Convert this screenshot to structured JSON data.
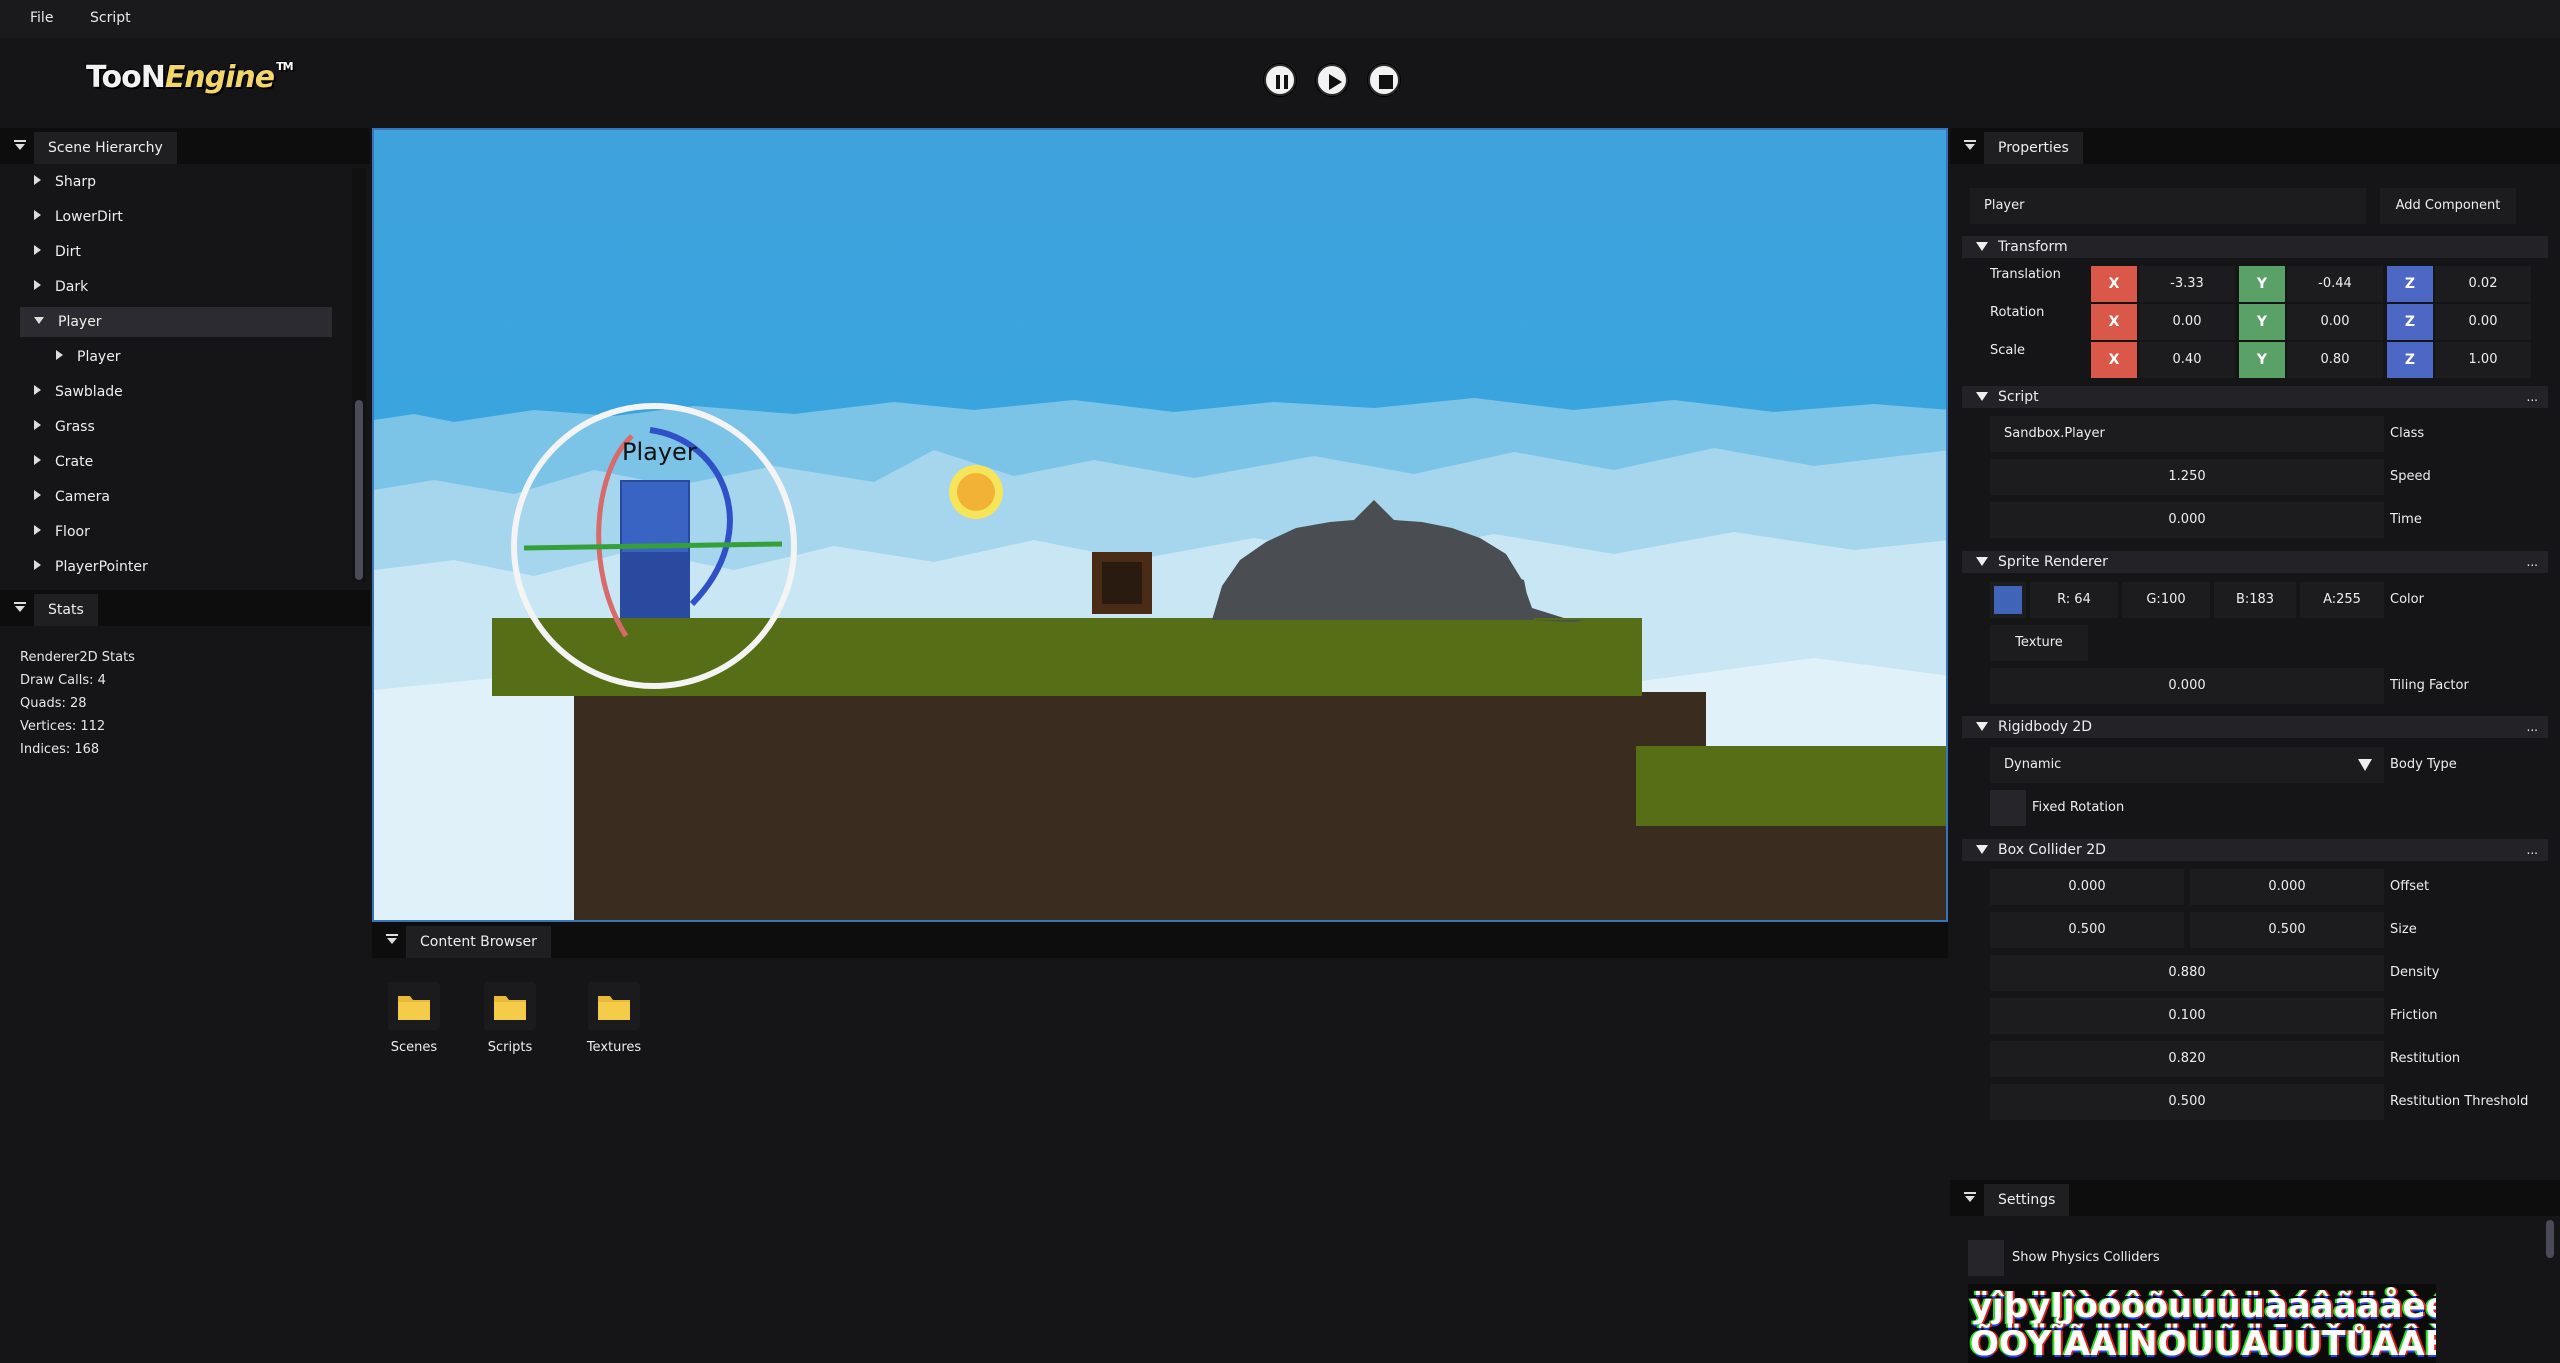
{
  "menu": {
    "file": "File",
    "script": "Script"
  },
  "logo": {
    "part1": "TooN",
    "part2": "Engine",
    "tm": "TM"
  },
  "playback": {
    "pause": "pause-icon",
    "play": "play-icon",
    "stop": "stop-icon"
  },
  "hierarchy": {
    "tab": "Scene Hierarchy",
    "items": [
      "Sharp",
      "LowerDirt",
      "Dirt",
      "Dark",
      "Player",
      "Player",
      "Sawblade",
      "Grass",
      "Crate",
      "Camera",
      "Floor",
      "PlayerPointer"
    ]
  },
  "stats": {
    "tab": "Stats",
    "title": "Renderer2D Stats",
    "draw_calls": "Draw Calls: 4",
    "quads": "Quads: 28",
    "vertices": "Vertices: 112",
    "indices": "Indices: 168"
  },
  "viewport": {
    "entity_label": "Player",
    "sky_color": "#3fa2dc",
    "grass_color": "#566e15",
    "dirt_color": "#3a2d1f"
  },
  "content_browser": {
    "tab": "Content Browser",
    "folders": [
      "Scenes",
      "Scripts",
      "Textures"
    ]
  },
  "properties": {
    "tab": "Properties",
    "entity_name": "Player",
    "add_component": "Add Component",
    "transform": {
      "header": "Transform",
      "translation_label": "Translation",
      "rotation_label": "Rotation",
      "scale_label": "Scale",
      "x": "X",
      "y": "Y",
      "z": "Z",
      "translation": [
        "-3.33",
        "-0.44",
        "0.02"
      ],
      "rotation": [
        "0.00",
        "0.00",
        "0.00"
      ],
      "scale": [
        "0.40",
        "0.80",
        "1.00"
      ]
    },
    "script": {
      "header": "Script",
      "dots": "...",
      "class_value": "Sandbox.Player",
      "class_label": "Class",
      "speed_value": "1.250",
      "speed_label": "Speed",
      "time_value": "0.000",
      "time_label": "Time"
    },
    "sprite": {
      "header": "Sprite Renderer",
      "dots": "...",
      "swatch": "#4064b7",
      "r": "R: 64",
      "g": "G:100",
      "b": "B:183",
      "a": "A:255",
      "color_label": "Color",
      "texture": "Texture",
      "tiling_value": "0.000",
      "tiling_label": "Tiling Factor"
    },
    "rigidbody": {
      "header": "Rigidbody 2D",
      "dots": "...",
      "body_type_value": "Dynamic",
      "body_type_label": "Body Type",
      "fixed_rotation": "Fixed Rotation"
    },
    "box_collider": {
      "header": "Box Collider 2D",
      "dots": "...",
      "offset": [
        "0.000",
        "0.000"
      ],
      "offset_label": "Offset",
      "size": [
        "0.500",
        "0.500"
      ],
      "size_label": "Size",
      "density": "0.880",
      "density_label": "Density",
      "friction": "0.100",
      "friction_label": "Friction",
      "restitution": "0.820",
      "restitution_label": "Restitution",
      "threshold": "0.500",
      "threshold_label": "Restitution Threshold"
    }
  },
  "settings": {
    "tab": "Settings",
    "show_colliders": "Show Physics Colliders",
    "font_atlas_1": "ÿĵþÿĮĵòóôõùúûüàáâãäåèéêëĩĪĭÆ",
    "font_atlas_2": "ÕÖŸĨÃÄÏŇÖÜŨÄŪÛŤŮÃÂÈŝ$&"
  },
  "colors": {
    "accent_x": "#d9584a",
    "accent_y": "#5aa168",
    "accent_z": "#4c67c4",
    "viewport_border": "#3a74b8"
  }
}
